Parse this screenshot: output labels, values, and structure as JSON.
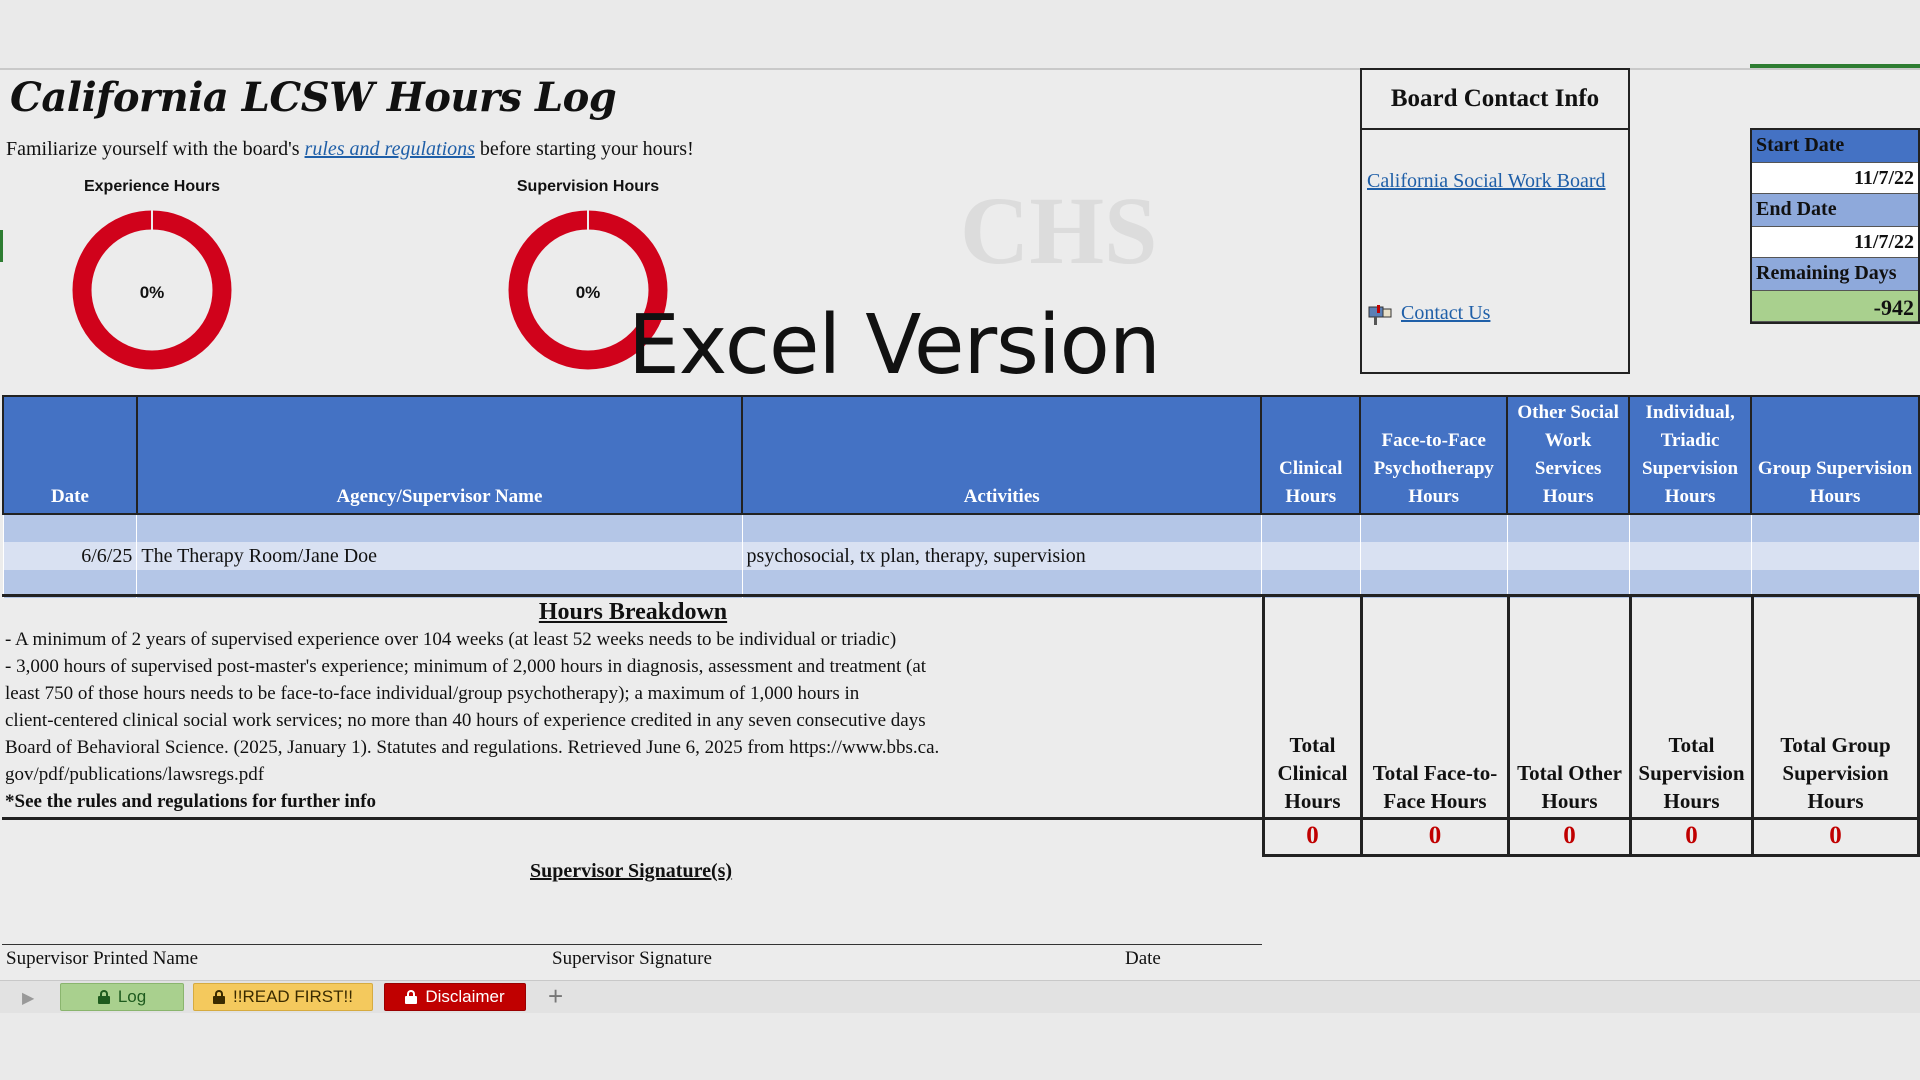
{
  "header": {
    "title": "California LCSW Hours Log",
    "intro_before": "Familiarize yourself with the board's ",
    "intro_link": "rules and regulations",
    "intro_after": " before starting your hours!"
  },
  "gauges": [
    {
      "label": "Experience Hours",
      "percent_text": "0%",
      "percent": 0
    },
    {
      "label": "Supervision Hours",
      "percent_text": "0%",
      "percent": 0
    }
  ],
  "watermark": "Excel Version",
  "board": {
    "title": "Board Contact Info",
    "link": "California Social Work Board",
    "contact": "Contact Us"
  },
  "dates": {
    "start_label": "Start Date",
    "start_value": "11/7/22",
    "end_label": "End Date",
    "end_value": "11/7/22",
    "remaining_label": "Remaining Days",
    "remaining_value": "-942"
  },
  "table": {
    "headers": [
      "Date",
      "Agency/Supervisor Name",
      "Activities",
      "Clinical Hours",
      "Face-to-Face Psychotherapy Hours",
      "Other Social Work Services Hours",
      "Individual, Triadic Supervision Hours",
      "Group Supervision Hours"
    ],
    "rows": [
      [
        "",
        "",
        "",
        "",
        "",
        "",
        "",
        ""
      ],
      [
        "6/6/25",
        "The Therapy Room/Jane Doe",
        "psychosocial, tx plan, therapy, supervision",
        "",
        "",
        "",
        "",
        ""
      ],
      [
        "",
        "",
        "",
        "",
        "",
        "",
        "",
        ""
      ]
    ]
  },
  "breakdown": {
    "title": "Hours Breakdown",
    "lines": [
      "- A minimum of 2 years of supervised experience over 104 weeks (at least 52 weeks needs to be individual or triadic)",
      "- 3,000 hours of supervised post-master's experience; minimum of 2,000 hours in diagnosis, assessment and treatment (at",
      "least 750 of those hours needs to be face-to-face individual/group psychotherapy); a maximum of 1,000 hours in",
      "client-centered clinical social work services; no more than 40 hours of experience credited in any seven consecutive days",
      "Board of Behavioral Science. (2025, January 1). Statutes and regulations. Retrieved June 6, 2025 from https://www.bbs.ca.",
      "gov/pdf/publications/lawsregs.pdf"
    ],
    "note": "*See the rules and regulations for further info"
  },
  "totals": [
    {
      "label": "Total Clinical Hours",
      "value": "0"
    },
    {
      "label": "Total Face-to-Face Hours",
      "value": "0"
    },
    {
      "label": "Total Other Hours",
      "value": "0"
    },
    {
      "label": "Total Supervision Hours",
      "value": "0"
    },
    {
      "label": "Total Group Supervision Hours",
      "value": "0"
    }
  ],
  "signature": {
    "title": "Supervisor Signature(s)",
    "printed_name": "Supervisor Printed Name",
    "signature": "Supervisor Signature",
    "date": "Date"
  },
  "tabs": [
    {
      "label": "Log",
      "color": "#a9d08e"
    },
    {
      "label": "!!READ FIRST!!",
      "color": "#f4c95d"
    },
    {
      "label": "Disclaimer",
      "color": "#c00000"
    }
  ],
  "colors": {
    "header_blue": "#4472c4",
    "gauge_red": "#d0021b",
    "total_red": "#c00000"
  }
}
